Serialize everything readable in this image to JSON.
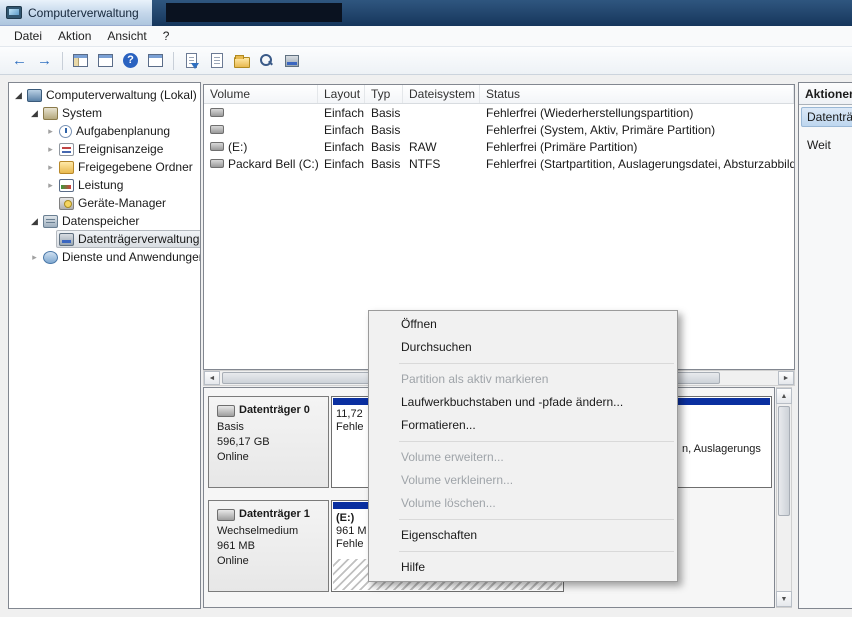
{
  "window": {
    "title": "Computerverwaltung",
    "icon": "computer-management-icon"
  },
  "menubar": {
    "items": [
      "Datei",
      "Aktion",
      "Ansicht",
      "?"
    ]
  },
  "toolbar": {
    "buttons": [
      "back",
      "forward",
      "show-console-tree",
      "console-window",
      "help",
      "new-window",
      "export-list",
      "properties",
      "open-folder",
      "search",
      "disk-settings"
    ]
  },
  "tree": {
    "items": [
      {
        "label": "Computerverwaltung (Lokal)",
        "icon": "computer-management-icon",
        "state": "expanded",
        "level": 0,
        "selected": false
      },
      {
        "label": "System",
        "icon": "system-tools-icon",
        "state": "expanded",
        "level": 1,
        "selected": false
      },
      {
        "label": "Aufgabenplanung",
        "icon": "task-scheduler-icon",
        "state": "collapsed",
        "level": 2,
        "selected": false
      },
      {
        "label": "Ereignisanzeige",
        "icon": "event-viewer-icon",
        "state": "collapsed",
        "level": 2,
        "selected": false
      },
      {
        "label": "Freigegebene Ordner",
        "icon": "shared-folders-icon",
        "state": "collapsed",
        "level": 2,
        "selected": false
      },
      {
        "label": "Leistung",
        "icon": "performance-icon",
        "state": "collapsed",
        "level": 2,
        "selected": false
      },
      {
        "label": "Geräte-Manager",
        "icon": "device-manager-icon",
        "state": "leaf",
        "level": 2,
        "selected": false
      },
      {
        "label": "Datenspeicher",
        "icon": "storage-icon",
        "state": "expanded",
        "level": 1,
        "selected": false
      },
      {
        "label": "Datenträgerverwaltung",
        "icon": "disk-management-icon",
        "state": "leaf",
        "level": 2,
        "selected": true
      },
      {
        "label": "Dienste und Anwendungen",
        "icon": "services-icon",
        "state": "collapsed",
        "level": 1,
        "selected": false
      }
    ]
  },
  "volume_table": {
    "columns": [
      "Volume",
      "Layout",
      "Typ",
      "Dateisystem",
      "Status"
    ],
    "rows": [
      {
        "volume": "",
        "layout": "Einfach",
        "typ": "Basis",
        "dateisystem": "",
        "status": "Fehlerfrei (Wiederherstellungspartition)"
      },
      {
        "volume": "",
        "layout": "Einfach",
        "typ": "Basis",
        "dateisystem": "",
        "status": "Fehlerfrei (System, Aktiv, Primäre Partition)"
      },
      {
        "volume": "(E:)",
        "layout": "Einfach",
        "typ": "Basis",
        "dateisystem": "RAW",
        "status": "Fehlerfrei (Primäre Partition)"
      },
      {
        "volume": "Packard Bell (C:)",
        "layout": "Einfach",
        "typ": "Basis",
        "dateisystem": "NTFS",
        "status": "Fehlerfrei (Startpartition, Auslagerungsdatei, Absturzabbild"
      }
    ]
  },
  "actions_panel": {
    "title": "Aktionen",
    "items": [
      {
        "label": "Datenträg",
        "selected": true
      },
      {
        "label": "Weit",
        "selected": false
      }
    ]
  },
  "disk_view": {
    "disks": [
      {
        "name": "Datenträger 0",
        "type": "Basis",
        "size": "596,17 GB",
        "status": "Online",
        "partitions": [
          {
            "lines": [
              "11,72",
              "Fehle"
            ],
            "selected": false
          },
          {
            "lines": [
              "n, Auslagerungs"
            ],
            "selected": false
          }
        ]
      },
      {
        "name": "Datenträger 1",
        "type": "Wechselmedium",
        "size": "961 MB",
        "status": "Online",
        "partitions": [
          {
            "lines": [
              "(E:)",
              "961 M",
              "Fehle"
            ],
            "selected": true
          }
        ]
      }
    ]
  },
  "context_menu": {
    "items": [
      {
        "label": "Öffnen",
        "enabled": true
      },
      {
        "label": "Durchsuchen",
        "enabled": true
      },
      {
        "type": "separator"
      },
      {
        "label": "Partition als aktiv markieren",
        "enabled": false
      },
      {
        "label": "Laufwerkbuchstaben und -pfade ändern...",
        "enabled": true
      },
      {
        "label": "Formatieren...",
        "enabled": true
      },
      {
        "type": "separator"
      },
      {
        "label": "Volume erweitern...",
        "enabled": false
      },
      {
        "label": "Volume verkleinern...",
        "enabled": false
      },
      {
        "label": "Volume löschen...",
        "enabled": false
      },
      {
        "type": "separator"
      },
      {
        "label": "Eigenschaften",
        "enabled": true
      },
      {
        "type": "separator"
      },
      {
        "label": "Hilfe",
        "enabled": true
      }
    ]
  },
  "colors": {
    "partition_band": "#0a2fa0",
    "selection_blue": "#bed7ef",
    "titlebar_dark": "#16365c"
  }
}
